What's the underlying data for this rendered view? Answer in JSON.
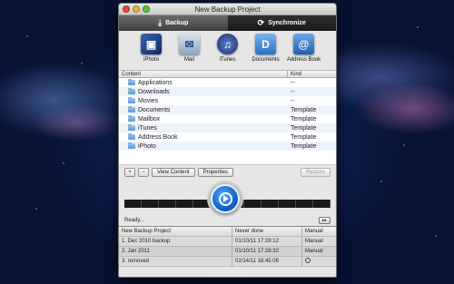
{
  "window": {
    "title": "New Backup Project"
  },
  "tabs": [
    {
      "label": "Backup",
      "icon": "download-icon"
    },
    {
      "label": "Synchronize",
      "icon": "sync-icon"
    }
  ],
  "toolbar": [
    {
      "label": "iPhoto",
      "icon": "iphoto-icon",
      "glyph": "▣"
    },
    {
      "label": "Mail",
      "icon": "mail-icon",
      "glyph": "✉"
    },
    {
      "label": "iTunes",
      "icon": "itunes-icon",
      "glyph": "♫"
    },
    {
      "label": "Documents",
      "icon": "documents-icon",
      "glyph": "D"
    },
    {
      "label": "Address Book",
      "icon": "address-book-icon",
      "glyph": "@"
    }
  ],
  "list": {
    "headers": {
      "content": "Content",
      "kind": "Kind"
    },
    "rows": [
      {
        "name": "Applications",
        "kind": "--"
      },
      {
        "name": "Downloads",
        "kind": "--"
      },
      {
        "name": "Movies",
        "kind": "--"
      },
      {
        "name": "Documents",
        "kind": "Template"
      },
      {
        "name": "Mailbox",
        "kind": "Template"
      },
      {
        "name": "iTunes",
        "kind": "Template"
      },
      {
        "name": "Address Book",
        "kind": "Template"
      },
      {
        "name": "iPhoto",
        "kind": "Template"
      }
    ]
  },
  "buttons": {
    "add": "+",
    "remove": "−",
    "view_content": "View Content",
    "properties": "Properties",
    "restore": "Restore"
  },
  "status": {
    "text": "Ready...",
    "ff": "▸▸"
  },
  "projects": {
    "headers": {
      "name": "New Backup Project",
      "last": "Never done",
      "mode": "Manual"
    },
    "rows": [
      {
        "name": "1. Dec 2010 backup",
        "date": "01/10/11 17:28:12",
        "mode": "Manual"
      },
      {
        "name": "2. Jan 2011",
        "date": "01/10/11 17:28:32",
        "mode": "Manual"
      },
      {
        "name": "3. removed",
        "date": "02/14/11 16:45:08",
        "mode": ""
      }
    ]
  },
  "colors": {
    "accent": "#0b58c4",
    "tab_active": "#3f3f3f"
  }
}
